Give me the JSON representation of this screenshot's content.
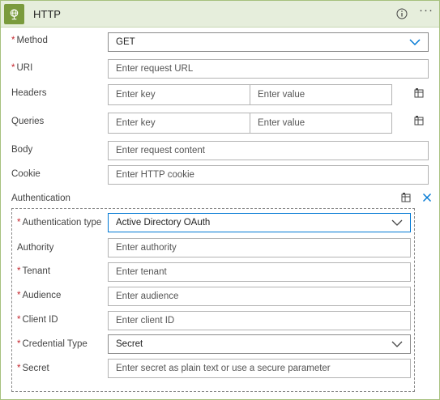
{
  "header": {
    "title": "HTTP",
    "action_icon": "globe-icon",
    "info_icon": "info-icon",
    "more_glyph": "···",
    "accent": "#7a9b3d",
    "bg": "#e6eedc"
  },
  "method": {
    "label": "Method",
    "required": "*",
    "value": "GET"
  },
  "uri": {
    "label": "URI",
    "required": "*",
    "placeholder": "Enter request URL"
  },
  "headers": {
    "label": "Headers",
    "key_placeholder": "Enter key",
    "value_placeholder": "Enter value"
  },
  "queries": {
    "label": "Queries",
    "key_placeholder": "Enter key",
    "value_placeholder": "Enter value"
  },
  "body": {
    "label": "Body",
    "placeholder": "Enter request content"
  },
  "cookie": {
    "label": "Cookie",
    "placeholder": "Enter HTTP cookie"
  },
  "authentication": {
    "label": "Authentication",
    "auth_type": {
      "label": "Authentication type",
      "required": "*",
      "value": "Active Directory OAuth"
    },
    "authority": {
      "label": "Authority",
      "placeholder": "Enter authority"
    },
    "tenant": {
      "label": "Tenant",
      "required": "*",
      "placeholder": "Enter tenant"
    },
    "audience": {
      "label": "Audience",
      "required": "*",
      "placeholder": "Enter audience"
    },
    "client_id": {
      "label": "Client ID",
      "required": "*",
      "placeholder": "Enter client ID"
    },
    "credential_type": {
      "label": "Credential Type",
      "required": "*",
      "value": "Secret"
    },
    "secret": {
      "label": "Secret",
      "required": "*",
      "placeholder": "Enter secret as plain text or use a secure parameter"
    }
  },
  "colors": {
    "required": "#c4262e",
    "focus": "#0078d4",
    "chevron": "#0078d4"
  }
}
